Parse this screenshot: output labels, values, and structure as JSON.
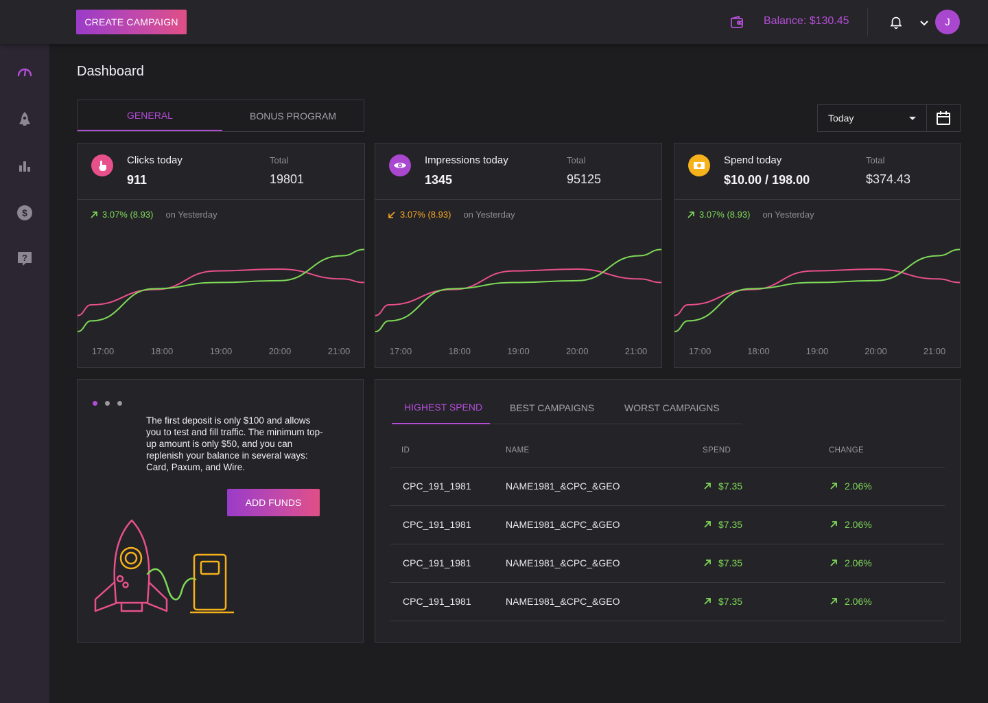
{
  "topbar": {
    "create_label": "CREATE CAMPAIGN",
    "balance": "Balance: $130.45",
    "avatar_initial": "J"
  },
  "page_title": "Dashboard",
  "main_tabs": [
    "GENERAL",
    "BONUS PROGRAM"
  ],
  "period": "Today",
  "colors": {
    "accent": "#b24ed6",
    "pink": "#e8508c",
    "green": "#7ed957",
    "orange": "#f5a623"
  },
  "cards": [
    {
      "icon": "hand-pointer-icon",
      "label": "Clicks today",
      "value": "911",
      "total_label": "Total",
      "total": "19801",
      "delta": "3.07% (8.93)",
      "delta_dir": "up",
      "delta_note": "on Yesterday"
    },
    {
      "icon": "eye-icon",
      "label": "Impressions today",
      "value": "1345",
      "total_label": "Total",
      "total": "95125",
      "delta": "3.07% (8.93)",
      "delta_dir": "down",
      "delta_note": "on Yesterday"
    },
    {
      "icon": "cash-icon",
      "label": "Spend today",
      "value": "$10.00 / 198.00",
      "total_label": "Total",
      "total": "$374.43",
      "delta": "3.07% (8.93)",
      "delta_dir": "up",
      "delta_note": "on Yesterday"
    }
  ],
  "chart_data": [
    {
      "type": "line",
      "x": [
        "17:00",
        "18:00",
        "19:00",
        "20:00",
        "21:00"
      ],
      "series": [
        {
          "color": "#e8508c",
          "values": [
            30,
            47,
            68,
            70,
            59
          ]
        },
        {
          "color": "#7ed957",
          "values": [
            12,
            48,
            55,
            57,
            85
          ]
        }
      ]
    },
    {
      "type": "line",
      "x": [
        "17:00",
        "18:00",
        "19:00",
        "20:00",
        "21:00"
      ],
      "series": [
        {
          "color": "#e8508c",
          "values": [
            30,
            47,
            68,
            70,
            59
          ]
        },
        {
          "color": "#7ed957",
          "values": [
            12,
            48,
            55,
            57,
            85
          ]
        }
      ]
    },
    {
      "type": "line",
      "x": [
        "17:00",
        "18:00",
        "19:00",
        "20:00",
        "21:00"
      ],
      "series": [
        {
          "color": "#e8508c",
          "values": [
            30,
            47,
            68,
            70,
            59
          ]
        },
        {
          "color": "#7ed957",
          "values": [
            12,
            48,
            55,
            57,
            85
          ]
        }
      ]
    }
  ],
  "promo": {
    "text": "The first deposit is only $100 and allows you to test and fill traffic. The minimum top-up amount is only $50, and you can replenish your balance in several ways: Card, Paxum, and Wire.",
    "button": "ADD FUNDS",
    "slide_count": 3
  },
  "campaigns": {
    "tabs": [
      "HIGHEST SPEND",
      "BEST CAMPAIGNS",
      "WORST CAMPAIGNS"
    ],
    "columns": [
      "ID",
      "NAME",
      "SPEND",
      "CHANGE"
    ],
    "rows": [
      {
        "id": "CPC_191_1981",
        "name": "NAME1981_&CPC_&GEO",
        "spend": "$7.35",
        "change": "2.06%"
      },
      {
        "id": "CPC_191_1981",
        "name": "NAME1981_&CPC_&GEO",
        "spend": "$7.35",
        "change": "2.06%"
      },
      {
        "id": "CPC_191_1981",
        "name": "NAME1981_&CPC_&GEO",
        "spend": "$7.35",
        "change": "2.06%"
      },
      {
        "id": "CPC_191_1981",
        "name": "NAME1981_&CPC_&GEO",
        "spend": "$7.35",
        "change": "2.06%"
      }
    ]
  }
}
